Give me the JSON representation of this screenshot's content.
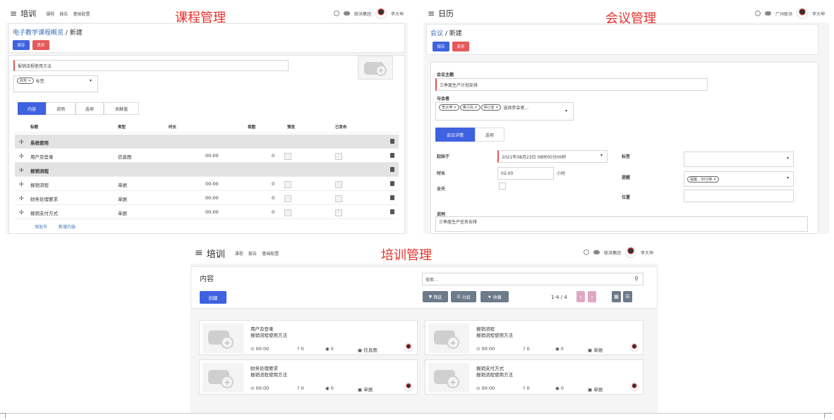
{
  "course": {
    "app_title": "培训",
    "menu": [
      "课程",
      "报告",
      "基础配置"
    ],
    "red_title": "课程管理",
    "company": "联洪集团",
    "user": "李大坤",
    "breadcrumb_link": "电子教学课程概览",
    "breadcrumb_sep": " / ",
    "breadcrumb_current": "新建",
    "save": "保存",
    "discard": "丢弃",
    "name_value": "报销流程使用方法",
    "tag_value": "财务",
    "tag_placeholder": "标签",
    "tabs": [
      "内容",
      "说明",
      "选项",
      "贡献值"
    ],
    "columns": [
      "标题",
      "类型",
      "时长",
      "视图",
      "预览",
      "已发布"
    ],
    "rows": [
      {
        "kind": "section",
        "title": "系统使用"
      },
      {
        "kind": "item",
        "title": "用户及登录",
        "type": "信息图",
        "time": "00:00",
        "views": "0"
      },
      {
        "kind": "section",
        "title": "报销流程"
      },
      {
        "kind": "item",
        "title": "报销流程",
        "type": "单据",
        "time": "00:00",
        "views": "0"
      },
      {
        "kind": "item",
        "title": "财务处理要求",
        "type": "单据",
        "time": "00:00",
        "views": "0"
      },
      {
        "kind": "item",
        "title": "报销支付方式",
        "type": "单据",
        "time": "00:00",
        "views": "0"
      }
    ],
    "add_section": "添加节",
    "add_content": "新增内容"
  },
  "meeting": {
    "app_title": "日历",
    "red_title": "会议管理",
    "company": "广州联洪",
    "user": "李大坤",
    "breadcrumb_link": "会议",
    "breadcrumb_sep": " / ",
    "breadcrumb_current": "新建",
    "save": "保存",
    "discard": "丢弃",
    "subject_label": "会议主题",
    "subject_value": "三季度生产计划安排",
    "attendees_label": "与会者",
    "attendees": [
      "李大坤",
      "黄小兵",
      "钟小亚"
    ],
    "attendees_placeholder": "选择参会者...",
    "tabs": [
      "会议详情",
      "选项"
    ],
    "start_label": "起始于",
    "start_value": "2021年08月23日 08时00分00秒",
    "duration_label": "时长",
    "duration_value": "02:00",
    "duration_unit": "小时",
    "allday_label": "全天",
    "tags_label": "标签",
    "reminder_label": "提醒",
    "reminder_value": "提醒 - 30分钟",
    "location_label": "位置",
    "desc_label": "说明",
    "desc_value": "三季度生产任务安排"
  },
  "training": {
    "app_title": "培训",
    "menu": [
      "课程",
      "报告",
      "基础配置"
    ],
    "red_title": "培训管理",
    "company": "联洪集团",
    "user": "李大坤",
    "page_title": "内容",
    "create": "创建",
    "search_placeholder": "搜索...",
    "filter": "筛选",
    "group": "分组",
    "favorite": "收藏",
    "pager": "1-4 / 4",
    "cards": [
      {
        "title": "用户及登录",
        "subtitle": "报销流程使用方法",
        "time": "00:00",
        "q": "0",
        "views": "0",
        "type": "信息图"
      },
      {
        "title": "报销流程",
        "subtitle": "报销流程使用方法",
        "time": "00:00",
        "q": "0",
        "views": "0",
        "type": "单据"
      },
      {
        "title": "财务处理要求",
        "subtitle": "报销流程使用方法",
        "time": "00:00",
        "q": "0",
        "views": "0",
        "type": "单据"
      },
      {
        "title": "报销支付方式",
        "subtitle": "报销流程使用方法",
        "time": "00:00",
        "q": "0",
        "views": "0",
        "type": "单据"
      }
    ]
  }
}
